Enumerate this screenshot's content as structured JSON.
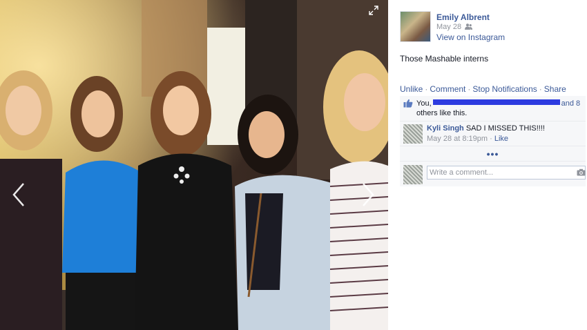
{
  "photo": {
    "alt_icons": [
      "expand-icon",
      "chevron-left-icon",
      "chevron-right-icon"
    ]
  },
  "post": {
    "author": "Emily Albrent",
    "date": "May 28",
    "audience_icon": "friends-icon",
    "via_link": "View on Instagram",
    "caption": "Those Mashable interns"
  },
  "actions": {
    "unlike": "Unlike",
    "comment": "Comment",
    "stop_notifications": "Stop Notifications",
    "share": "Share",
    "separator": "·"
  },
  "likes": {
    "icon": "thumbs-up-icon",
    "you": "You,",
    "others": "and 8",
    "others_tail": "others like this."
  },
  "comments": [
    {
      "author": "Kyli Singh",
      "text": "SAD I MISSED THIS!!!!",
      "timestamp": "May 28 at 8:19pm",
      "like_label": "Like",
      "separator": "·"
    }
  ],
  "more": {
    "label": "•••"
  },
  "composer": {
    "placeholder": "Write a comment...",
    "icon": "camera-icon"
  },
  "colors": {
    "link": "#3b5998",
    "muted": "#90949c",
    "ufi_bg": "#f6f7f9",
    "redaction": "#2d3be0"
  }
}
